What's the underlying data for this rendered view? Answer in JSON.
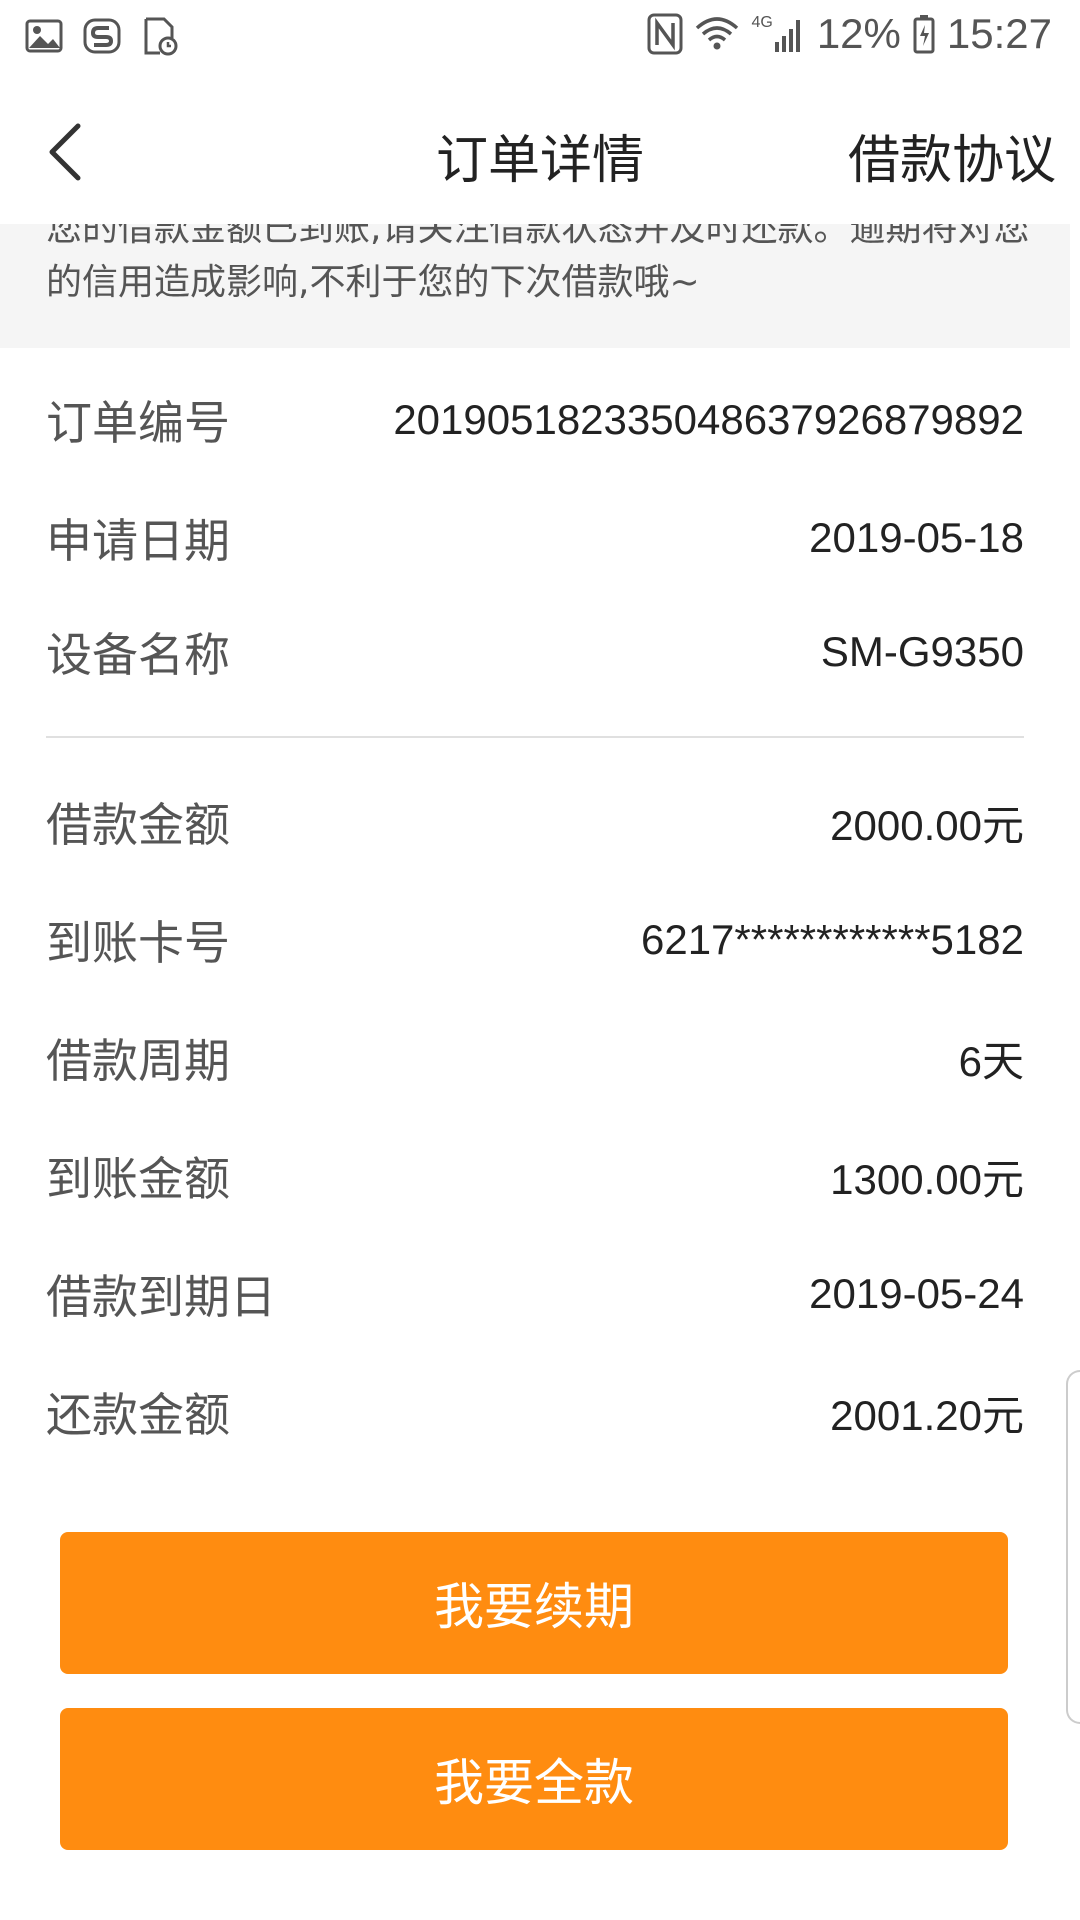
{
  "status_bar": {
    "battery": "12%",
    "time": "15:27",
    "network": "4G"
  },
  "nav": {
    "title": "订单详情",
    "right_link": "借款协议"
  },
  "notice": {
    "text": "您的借款金额已到账,请关注借款状态并及时还款。逾期将对您的信用造成影响,不利于您的下次借款哦~"
  },
  "order_info": [
    {
      "label": "订单编号",
      "value": "20190518233504863792687989​2"
    },
    {
      "label": "申请日期",
      "value": "2019-05-18"
    },
    {
      "label": "设备名称",
      "value": "SM-G9350"
    }
  ],
  "loan_info": [
    {
      "label": "借款金额",
      "value": "2000.00元"
    },
    {
      "label": "到账卡号",
      "value": "6217************5182"
    },
    {
      "label": "借款周期",
      "value": "6天"
    },
    {
      "label": "到账金额",
      "value": "1300.00元"
    },
    {
      "label": "借款到期日",
      "value": "2019-05-24"
    },
    {
      "label": "还款金额",
      "value": "2001.20元"
    }
  ],
  "buttons": {
    "renew": "我要续期",
    "full_repay": "我要全款"
  },
  "colors": {
    "accent": "#ff8c10",
    "notice_bg": "#f5f5f5"
  }
}
